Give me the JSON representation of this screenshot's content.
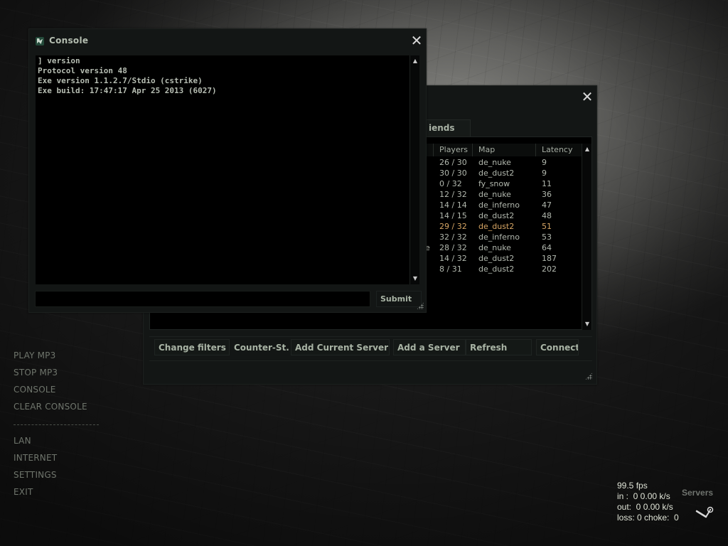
{
  "main_menu": {
    "items_top": [
      "PLAY MP3",
      "STOP MP3",
      "CONSOLE",
      "CLEAR CONSOLE"
    ],
    "items_bottom": [
      "LAN",
      "INTERNET",
      "SETTINGS",
      "EXIT"
    ]
  },
  "console": {
    "title": "Console",
    "icon": "game-logo-icon",
    "lines": [
      "] version",
      "Protocol version 48",
      "Exe version 1.1.2.7/Stdio (cstrike)",
      "Exe build: 17:47:17 Apr 25 2013 (6027)"
    ],
    "input_value": "",
    "submit_label": "Submit"
  },
  "server_browser": {
    "visible_tab": "iends",
    "columns": [
      "Players",
      "Map",
      "Latency"
    ],
    "rows": [
      {
        "name": "",
        "players": "26 / 30",
        "map": "de_nuke",
        "latency": "9",
        "highlight": false
      },
      {
        "name": "",
        "players": "30 / 30",
        "map": "de_dust2",
        "latency": "9",
        "highlight": false
      },
      {
        "name": "",
        "players": "0 / 32",
        "map": "fy_snow",
        "latency": "11",
        "highlight": false
      },
      {
        "name": "",
        "players": "12 / 32",
        "map": "de_nuke",
        "latency": "36",
        "highlight": false
      },
      {
        "name": "",
        "players": "14 / 14",
        "map": "de_inferno",
        "latency": "47",
        "highlight": false
      },
      {
        "name": "",
        "players": "14 / 15",
        "map": "de_dust2",
        "latency": "48",
        "highlight": false
      },
      {
        "name": "",
        "players": "29 / 32",
        "map": "de_dust2",
        "latency": "51",
        "highlight": true
      },
      {
        "name": "",
        "players": "32 / 32",
        "map": "de_inferno",
        "latency": "53",
        "highlight": false
      },
      {
        "name": "ike",
        "players": "28 / 32",
        "map": "de_nuke",
        "latency": "64",
        "highlight": false
      },
      {
        "name": "",
        "players": "14 / 32",
        "map": "de_dust2",
        "latency": "187",
        "highlight": false
      },
      {
        "name": "",
        "players": "8 / 31",
        "map": "de_dust2",
        "latency": "202",
        "highlight": false
      }
    ],
    "buttons": {
      "change_filters": "Change filters",
      "game_filter": "Counter-St..",
      "add_current_server": "Add Current Server",
      "add_server": "Add a Server",
      "refresh": "Refresh",
      "connect": "Connect"
    }
  },
  "net_graph": {
    "fps": "99.5 fps",
    "in": "in :  0 0.00 k/s",
    "out": "out:  0 0.00 k/s",
    "loss": "loss: 0 choke:  0"
  },
  "servers_label": "Servers",
  "colors": {
    "highlight_row": "#d6a564",
    "text": "#b2b8ae",
    "menu_text": "#6f756c"
  }
}
